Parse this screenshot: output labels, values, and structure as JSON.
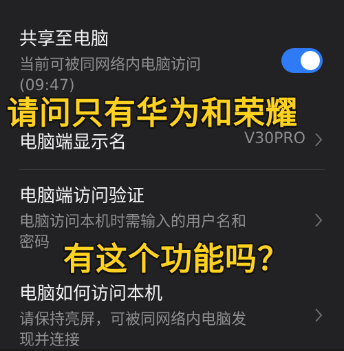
{
  "settings": {
    "share_to_pc": {
      "title": "共享至电脑",
      "subtitle_line1": "当前可被同网络内电脑访问",
      "subtitle_line2": "(09:47)",
      "toggle_on": true
    },
    "pc_display_name": {
      "title": "电脑端显示名",
      "value": "V30PRO"
    },
    "pc_access_verification": {
      "title": "电脑端访问验证",
      "subtitle_line1": "电脑访问本机时需输入的用户名和",
      "subtitle_line2": "密码"
    },
    "how_pc_access": {
      "title": "电脑如何访问本机",
      "subtitle_line1": "请保持亮屏，可被同网络内电脑发",
      "subtitle_line2": "现并连接"
    }
  },
  "overlay": {
    "caption_line1": "请问只有华为和荣耀",
    "caption_line2": "有这个功能吗？"
  },
  "colors": {
    "toggle_accent": "#2f7bf5",
    "caption_yellow": "#ffd21f"
  }
}
